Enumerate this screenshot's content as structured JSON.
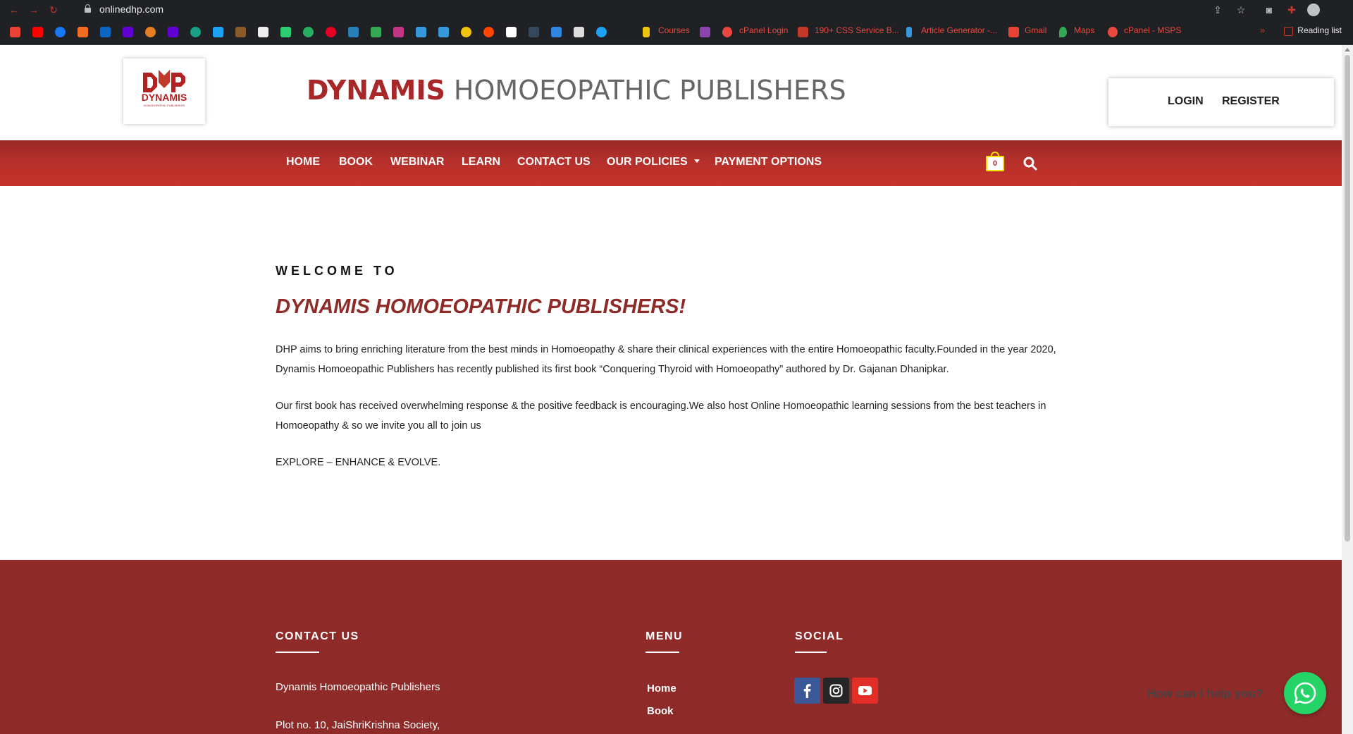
{
  "browser": {
    "url": "onlinedhp.com",
    "bookmarks": {
      "courses": "Courses",
      "cpanel_login": "cPanel Login",
      "css_service": "190+ CSS Service B...",
      "article_generator": "Article Generator -...",
      "gmail": "Gmail",
      "maps": "Maps",
      "cpanel_msps": "cPanel - MSPS",
      "more": "»",
      "reading_list": "Reading list"
    }
  },
  "header": {
    "logo_word": "DYNAMIS",
    "logo_tagline": "HOMOEOPATHIC PUBLISHERS",
    "title_strong": "DYNAMIS",
    "title_light": "HOMOEOPATHIC PUBLISHERS",
    "login": "LOGIN",
    "register": "REGISTER"
  },
  "nav": {
    "home": "HOME",
    "book": "BOOK",
    "webinar": "WEBINAR",
    "learn": "LEARN",
    "contact": "CONTACT US",
    "policies": "OUR POLICIES",
    "payment": "PAYMENT OPTIONS",
    "cart_count": "0"
  },
  "main": {
    "welcome": "WELCOME TO",
    "headline": "DYNAMIS HOMOEOPATHIC PUBLISHERS!",
    "para1": "DHP aims to bring enriching literature from the best minds in Homoeopathy & share their clinical experiences with the entire Homoeopathic faculty.Founded in the year 2020, Dynamis Homoeopathic Publishers has recently published its first book “Conquering Thyroid with Homoeopathy” authored by Dr. Gajanan Dhanipkar.",
    "para2": "Our first book has received overwhelming response & the positive feedback is encouraging.We also host Online Homoeopathic learning sessions from the best teachers in Homoeopathy & so we invite you all to join us",
    "para3": "EXPLORE – ENHANCE & EVOLVE."
  },
  "footer": {
    "contact_head": "CONTACT US",
    "menu_head": "MENU",
    "social_head": "SOCIAL",
    "company": "Dynamis Homoeopathic Publishers",
    "address_line1": "Plot no. 10, JaiShriKrishna Society,",
    "menu_home": "Home",
    "menu_book": "Book"
  },
  "chat": {
    "prompt": "How can I help you?"
  },
  "colors": {
    "brand": "#8e2b28",
    "nav": "#b52f2a",
    "whatsapp": "#25d366"
  }
}
